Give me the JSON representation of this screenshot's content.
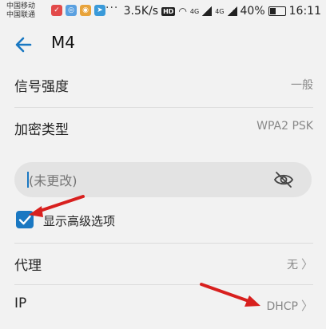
{
  "status_bar": {
    "carrier1": "中国移动",
    "carrier2": "中国联通",
    "speed": "3.5K/s",
    "hd": "HD",
    "net1": "4G",
    "net2": "4G",
    "battery": "40%",
    "battery_level": 0.4,
    "time": "16:11"
  },
  "header": {
    "title": "M4"
  },
  "signal": {
    "label": "信号强度",
    "value": "一般"
  },
  "security": {
    "label": "加密类型",
    "value": "WPA2 PSK"
  },
  "password": {
    "placeholder": "(未更改)"
  },
  "advanced": {
    "label": "显示高级选项",
    "checked": true
  },
  "proxy": {
    "label": "代理",
    "value": "无"
  },
  "ip": {
    "label": "IP",
    "value": "DHCP"
  },
  "colors": {
    "accent": "#1a78c2",
    "annotation_arrow": "#d8201e",
    "background": "#f2f2f2"
  },
  "icons": [
    "back-arrow-icon",
    "eye-off-icon",
    "checkmark-icon",
    "chevron-right-icon"
  ]
}
